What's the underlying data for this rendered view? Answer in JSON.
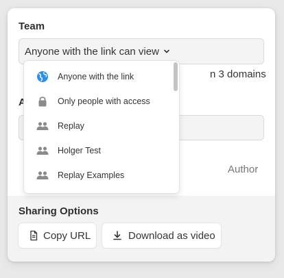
{
  "team": {
    "title": "Team",
    "select_value": "Anyone with the link can view",
    "domains_text": "n 3 domains"
  },
  "second_section": {
    "title_fragment": "A",
    "author_label": "Author"
  },
  "dropdown": {
    "items": [
      {
        "label": "Anyone with the link",
        "icon": "globe-icon"
      },
      {
        "label": "Only people with access",
        "icon": "lock-icon"
      },
      {
        "label": "Replay",
        "icon": "team-icon"
      },
      {
        "label": "Holger Test",
        "icon": "team-icon"
      },
      {
        "label": "Replay Examples",
        "icon": "team-icon"
      }
    ]
  },
  "sharing": {
    "title": "Sharing Options",
    "copy_label": "Copy URL",
    "download_label": "Download as video"
  },
  "colors": {
    "globe": "#2f8fe0",
    "icon_gray": "#8a8a8a",
    "panel_bg": "#f3f3f3"
  }
}
